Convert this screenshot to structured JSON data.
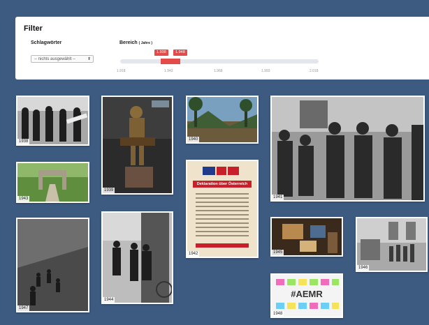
{
  "filter": {
    "title": "Filter",
    "keywords_label": "Schlagwörter",
    "keywords_select": "-- nichts ausgewählt --",
    "range_label": "Bereich",
    "range_unit": "( Jahre )",
    "range_from": "1.938",
    "range_to": "1.948",
    "ticks": [
      "1.918",
      "1.943",
      "1.968",
      "1.993",
      "2.018"
    ]
  },
  "photos": [
    {
      "year": "1938"
    },
    {
      "year": "1939"
    },
    {
      "year": "1940"
    },
    {
      "year": "1941"
    },
    {
      "year": "1943"
    },
    {
      "year": "1942",
      "poster_title": "Deklaration über Österreich"
    },
    {
      "year": "1945"
    },
    {
      "year": "1946"
    },
    {
      "year": "1947"
    },
    {
      "year": "1944"
    },
    {
      "year": "1948",
      "poster_text": "#AEMR"
    }
  ],
  "colors": {
    "background": "#3d5a80",
    "accent": "#e34b4b"
  }
}
